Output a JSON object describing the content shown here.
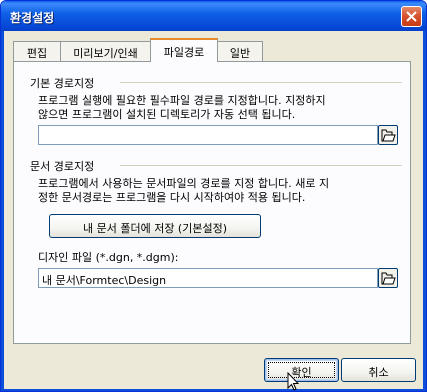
{
  "window": {
    "title": "환경설정"
  },
  "tabs": [
    {
      "label": "편집"
    },
    {
      "label": "미리보기/인쇄"
    },
    {
      "label": "파일경로"
    },
    {
      "label": "일반"
    }
  ],
  "active_tab": "파일경로",
  "base_path": {
    "title": "기본 경로지정",
    "desc_line1": "프로그램 실행에 필요한 필수파일 경로를 지정합니다. 지정하지",
    "desc_line2": "않으면 프로그램이 설치된 디렉토리가 자동 선택 됩니다.",
    "value": ""
  },
  "doc_path": {
    "title": "문서 경로지정",
    "desc_line1": "프로그램에서 사용하는 문서파일의 경로를 지정 합니다. 새로 지",
    "desc_line2": "정한 문서경로는 프로그램을 다시 시작하여야 적용 됩니다.",
    "save_button": "내 문서 폴더에 저장 (기본설정)",
    "design_label": "디자인 파일 (*.dgn, *.dgm):",
    "design_value": "내 문서\\Formtec\\Design"
  },
  "buttons": {
    "ok": "확인",
    "cancel": "취소"
  },
  "icons": {
    "close": "close-icon",
    "browse": "open-folder-icon",
    "cursor": "mouse-pointer-icon"
  },
  "colors": {
    "titlebar": "#0a5fee",
    "active_tab_highlight": "#e68b2c",
    "dialog_bg": "#ece9d8"
  }
}
